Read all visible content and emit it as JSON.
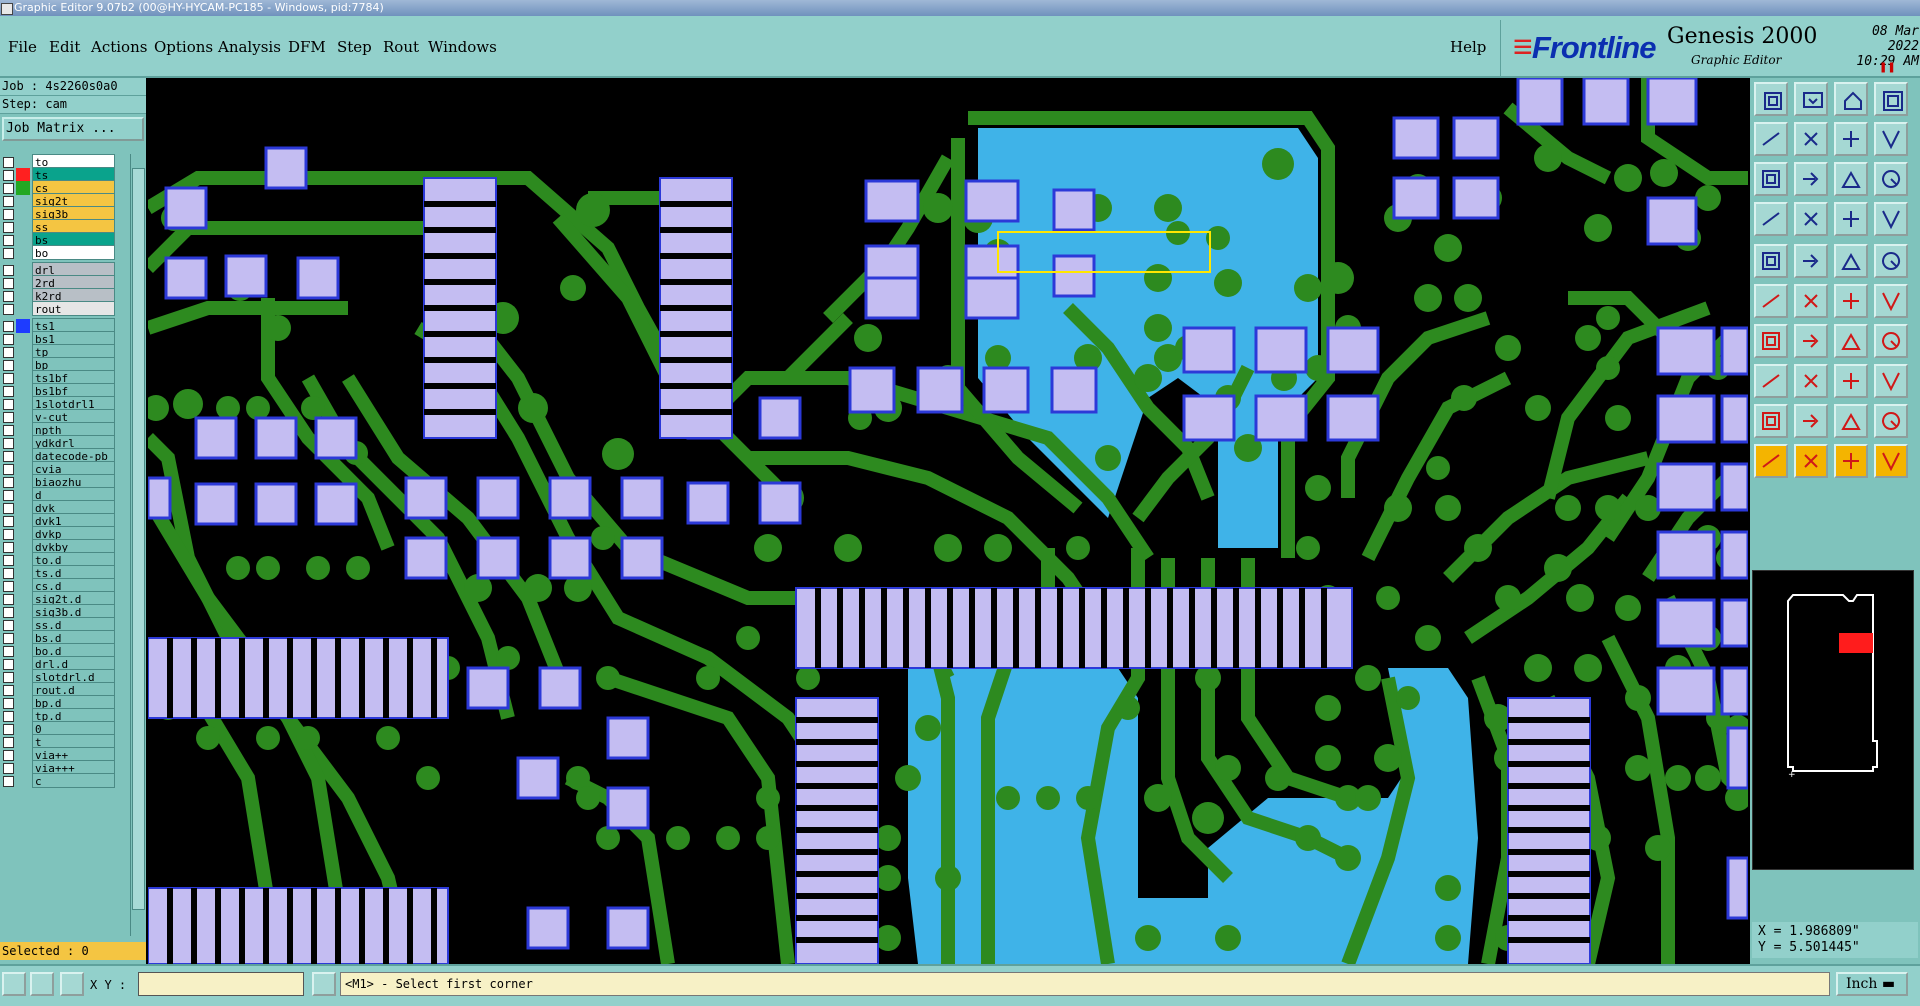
{
  "window": {
    "title": "Graphic Editor 9.07b2 (00@HY-HYCAM-PC185 - Windows, pid:7784)"
  },
  "menu": [
    "File",
    "Edit",
    "Actions",
    "Options",
    "Analysis",
    "DFM",
    "Step",
    "Rout",
    "Windows"
  ],
  "help_label": "Help",
  "brand": {
    "logo": "Frontline",
    "product": "Genesis 2000",
    "subtitle": "Graphic Editor",
    "date": "08 Mar 2022",
    "time": "10:29 AM",
    "pause_icon": "pause-icon",
    "logo_color": "#0b2fb0"
  },
  "left": {
    "job": "Job : 4s2260s0a0",
    "step": "Step: cam",
    "job_matrix": "Job Matrix ..."
  },
  "layers": [
    {
      "name": "to",
      "bg": "#ffffff",
      "swatch": "",
      "arrow": true,
      "checked": false
    },
    {
      "name": "ts",
      "bg": "#0aa38c",
      "swatch": "#ff2020",
      "arrow": true,
      "checked": false
    },
    {
      "name": "cs",
      "bg": "#f4c542",
      "swatch": "#23a823",
      "arrow": true,
      "checked": false
    },
    {
      "name": "sig2t",
      "bg": "#f4c542",
      "swatch": "",
      "arrow": false,
      "checked": false
    },
    {
      "name": "sig3b",
      "bg": "#f4c542",
      "swatch": "",
      "arrow": false,
      "checked": false
    },
    {
      "name": "ss",
      "bg": "#f4c542",
      "swatch": "",
      "arrow": true,
      "checked": false
    },
    {
      "name": "bs",
      "bg": "#0aa38c",
      "swatch": "",
      "arrow": false,
      "checked": false
    },
    {
      "name": "bo",
      "bg": "#ffffff",
      "swatch": "",
      "arrow": false,
      "checked": false
    },
    {
      "name": "drl",
      "bg": "#b8bfc6",
      "swatch": "",
      "arrow": false,
      "checked": false,
      "gap": true
    },
    {
      "name": "2rd",
      "bg": "#b8bfc6",
      "swatch": "",
      "arrow": false,
      "checked": false
    },
    {
      "name": "k2rd",
      "bg": "#b8bfc6",
      "swatch": "",
      "arrow": false,
      "checked": false
    },
    {
      "name": "rout",
      "bg": "#e6e6e6",
      "swatch": "",
      "arrow": false,
      "checked": false
    },
    {
      "name": "ts1",
      "bg": "#7fc3bc",
      "swatch": "#1e3cff",
      "arrow": false,
      "checked": false,
      "gap": true
    },
    {
      "name": "bs1",
      "bg": "#7fc3bc",
      "swatch": "",
      "arrow": false,
      "checked": false
    },
    {
      "name": "tp",
      "bg": "#7fc3bc",
      "swatch": "",
      "arrow": false,
      "checked": false
    },
    {
      "name": "bp",
      "bg": "#7fc3bc",
      "swatch": "",
      "arrow": false,
      "checked": false
    },
    {
      "name": "ts1bf",
      "bg": "#7fc3bc",
      "swatch": "",
      "arrow": false,
      "checked": false
    },
    {
      "name": "bs1bf",
      "bg": "#7fc3bc",
      "swatch": "",
      "arrow": false,
      "checked": false
    },
    {
      "name": "1slotdrl1",
      "bg": "#7fc3bc",
      "swatch": "",
      "arrow": false,
      "checked": false
    },
    {
      "name": "v-cut",
      "bg": "#7fc3bc",
      "swatch": "",
      "arrow": false,
      "checked": false
    },
    {
      "name": "npth",
      "bg": "#7fc3bc",
      "swatch": "",
      "arrow": false,
      "checked": false
    },
    {
      "name": "ydkdrl",
      "bg": "#7fc3bc",
      "swatch": "",
      "arrow": false,
      "checked": false
    },
    {
      "name": "datecode-pb",
      "bg": "#7fc3bc",
      "swatch": "",
      "arrow": false,
      "checked": false
    },
    {
      "name": "cvia",
      "bg": "#7fc3bc",
      "swatch": "",
      "arrow": false,
      "checked": false
    },
    {
      "name": "biaozhu",
      "bg": "#7fc3bc",
      "swatch": "",
      "arrow": false,
      "checked": false
    },
    {
      "name": "d",
      "bg": "#7fc3bc",
      "swatch": "",
      "arrow": false,
      "checked": false
    },
    {
      "name": "dvk",
      "bg": "#7fc3bc",
      "swatch": "",
      "arrow": false,
      "checked": false
    },
    {
      "name": "dvk1",
      "bg": "#7fc3bc",
      "swatch": "",
      "arrow": false,
      "checked": false
    },
    {
      "name": "dvkp",
      "bg": "#7fc3bc",
      "swatch": "",
      "arrow": false,
      "checked": false
    },
    {
      "name": "dvkby",
      "bg": "#7fc3bc",
      "swatch": "",
      "arrow": false,
      "checked": false
    },
    {
      "name": "to.d",
      "bg": "#7fc3bc",
      "swatch": "",
      "arrow": true,
      "checked": false
    },
    {
      "name": "ts.d",
      "bg": "#7fc3bc",
      "swatch": "",
      "arrow": false,
      "checked": false
    },
    {
      "name": "cs.d",
      "bg": "#7fc3bc",
      "swatch": "",
      "arrow": true,
      "checked": false
    },
    {
      "name": "sig2t.d",
      "bg": "#7fc3bc",
      "swatch": "",
      "arrow": false,
      "checked": false
    },
    {
      "name": "sig3b.d",
      "bg": "#7fc3bc",
      "swatch": "",
      "arrow": false,
      "checked": false
    },
    {
      "name": "ss.d",
      "bg": "#7fc3bc",
      "swatch": "",
      "arrow": true,
      "checked": false
    },
    {
      "name": "bs.d",
      "bg": "#7fc3bc",
      "swatch": "",
      "arrow": false,
      "checked": false
    },
    {
      "name": "bo.d",
      "bg": "#7fc3bc",
      "swatch": "",
      "arrow": false,
      "checked": false
    },
    {
      "name": "drl.d",
      "bg": "#7fc3bc",
      "swatch": "",
      "arrow": false,
      "checked": false
    },
    {
      "name": "slotdrl.d",
      "bg": "#7fc3bc",
      "swatch": "",
      "arrow": false,
      "checked": false
    },
    {
      "name": "rout.d",
      "bg": "#7fc3bc",
      "swatch": "",
      "arrow": false,
      "checked": false
    },
    {
      "name": "bp.d",
      "bg": "#7fc3bc",
      "swatch": "",
      "arrow": false,
      "checked": false
    },
    {
      "name": "tp.d",
      "bg": "#7fc3bc",
      "swatch": "",
      "arrow": false,
      "checked": false
    },
    {
      "name": "0",
      "bg": "#7fc3bc",
      "swatch": "",
      "arrow": false,
      "checked": false
    },
    {
      "name": "t",
      "bg": "#7fc3bc",
      "swatch": "",
      "arrow": false,
      "checked": false
    },
    {
      "name": "via++",
      "bg": "#7fc3bc",
      "swatch": "",
      "arrow": false,
      "checked": false
    },
    {
      "name": "via+++",
      "bg": "#7fc3bc",
      "swatch": "",
      "arrow": false,
      "checked": false
    },
    {
      "name": "c",
      "bg": "#7fc3bc",
      "swatch": "",
      "arrow": false,
      "checked": false
    }
  ],
  "selected": "Selected : 0",
  "coords": {
    "x": "X = 1.986809\"",
    "y": "Y = 5.501445\""
  },
  "status": {
    "xy_label": "X Y :",
    "xy_value": "",
    "prompt": "<M1> - Select first corner",
    "units": "Inch"
  },
  "colors": {
    "copper": "#2d8a1f",
    "mask": "#3fb3e8",
    "pad": "#c4bdf2",
    "pad_outline": "#2c39d8",
    "pad_outline2": "#ff3cff",
    "highlight": "#ffe600",
    "panel": "#92d0cb"
  },
  "tools": [
    "open-job-icon",
    "save-icon",
    "home-icon",
    "zoom-fit-icon",
    "import-icon",
    "export-icon",
    "step-left-icon",
    "step-right-icon",
    "pan-icon",
    "zoom-icon",
    "ratio-icon",
    "help-icon",
    "measure-icon",
    "snap-icon",
    "layer-add-icon",
    "layer-del-icon",
    "select-box-icon",
    "erase-icon",
    "line-icon",
    "pad-icon",
    "connect-icon",
    "cross-icon",
    "route-icon",
    "drill-icon",
    "edit-line-icon",
    "slant-icon",
    "arc-icon",
    "text-icon",
    "copy-icon",
    "move-icon",
    "align-icon",
    "array-icon",
    "triangle-icon",
    "poly-icon",
    "outline-icon",
    "surface-icon",
    "pointer-icon",
    "pointer-box-icon",
    "rotate-icon",
    "transform-icon"
  ]
}
